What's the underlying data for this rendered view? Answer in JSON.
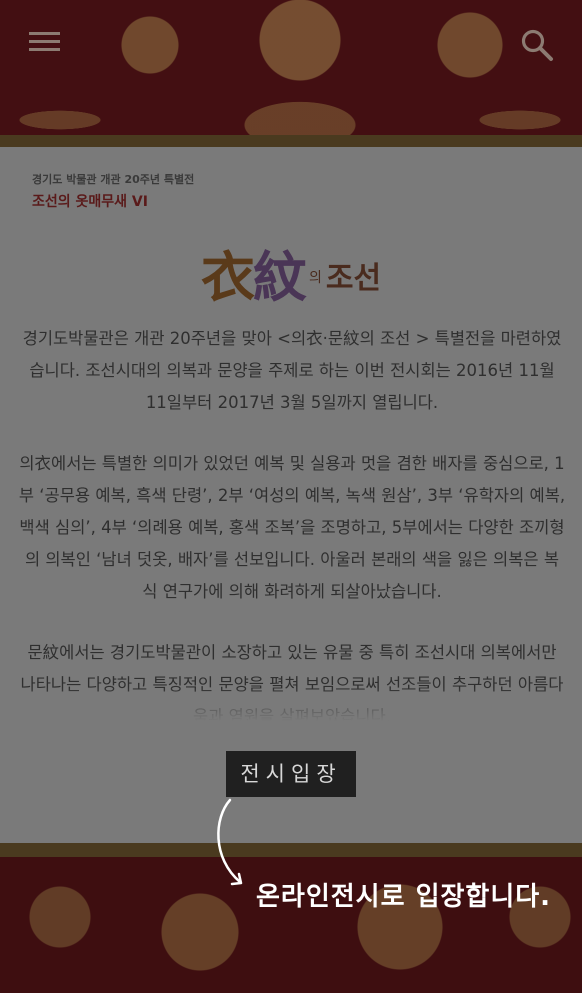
{
  "header": {
    "menu_icon": "hamburger-menu-icon",
    "search_icon": "magnifier-search-icon"
  },
  "content": {
    "sub_header": "경기도 박물관 개관 20주년 특별전",
    "sub_title": "조선의 옷매무새 VI",
    "logo": {
      "hanja_1": "衣",
      "hanja_2": "紋",
      "particle": "의",
      "word": "조선"
    },
    "paragraphs": [
      "경기도박물관은 개관 20주년을 맞아 <의衣·문紋의 조선 > 특별전을 마련하였습니다. 조선시대의 의복과 문양을 주제로 하는 이번 전시회는 2016년 11월 11일부터 2017년 3월 5일까지 열립니다.",
      "의衣에서는 특별한 의미가 있었던 예복 및 실용과 멋을 겸한 배자를 중심으로, 1부 ‘공무용 예복, 흑색 단령’, 2부 ‘여성의 예복, 녹색 원삼’, 3부 ‘유학자의 예복, 백색 심의’, 4부 ‘의례용 예복, 홍색 조복’을 조명하고, 5부에서는 다양한 조끼형의 의복인 ‘남녀 덧옷, 배자’를 선보입니다. 아울러 본래의 색을 잃은 의복은 복식 연구가에 의해 화려하게 되살아났습니다.",
      "문紋에서는 경기도박물관이 소장하고 있는 유물 중 특히 조선시대 의복에서만 나타나는 다양하고 특징적인 문양을 펼쳐 보임으로써 선조들이 추구하던 아름다움과 염원을 살펴보았습니다."
    ],
    "enter_button": "전시입장"
  },
  "footer": {
    "hint": "온라인전시로 입장합니다."
  },
  "colors": {
    "overlay": "#7a7a7a",
    "banner": "#5a1518",
    "gold_line": "#4a3a1f",
    "button_bg": "#202020",
    "sub_title": "#5a1a1a"
  }
}
